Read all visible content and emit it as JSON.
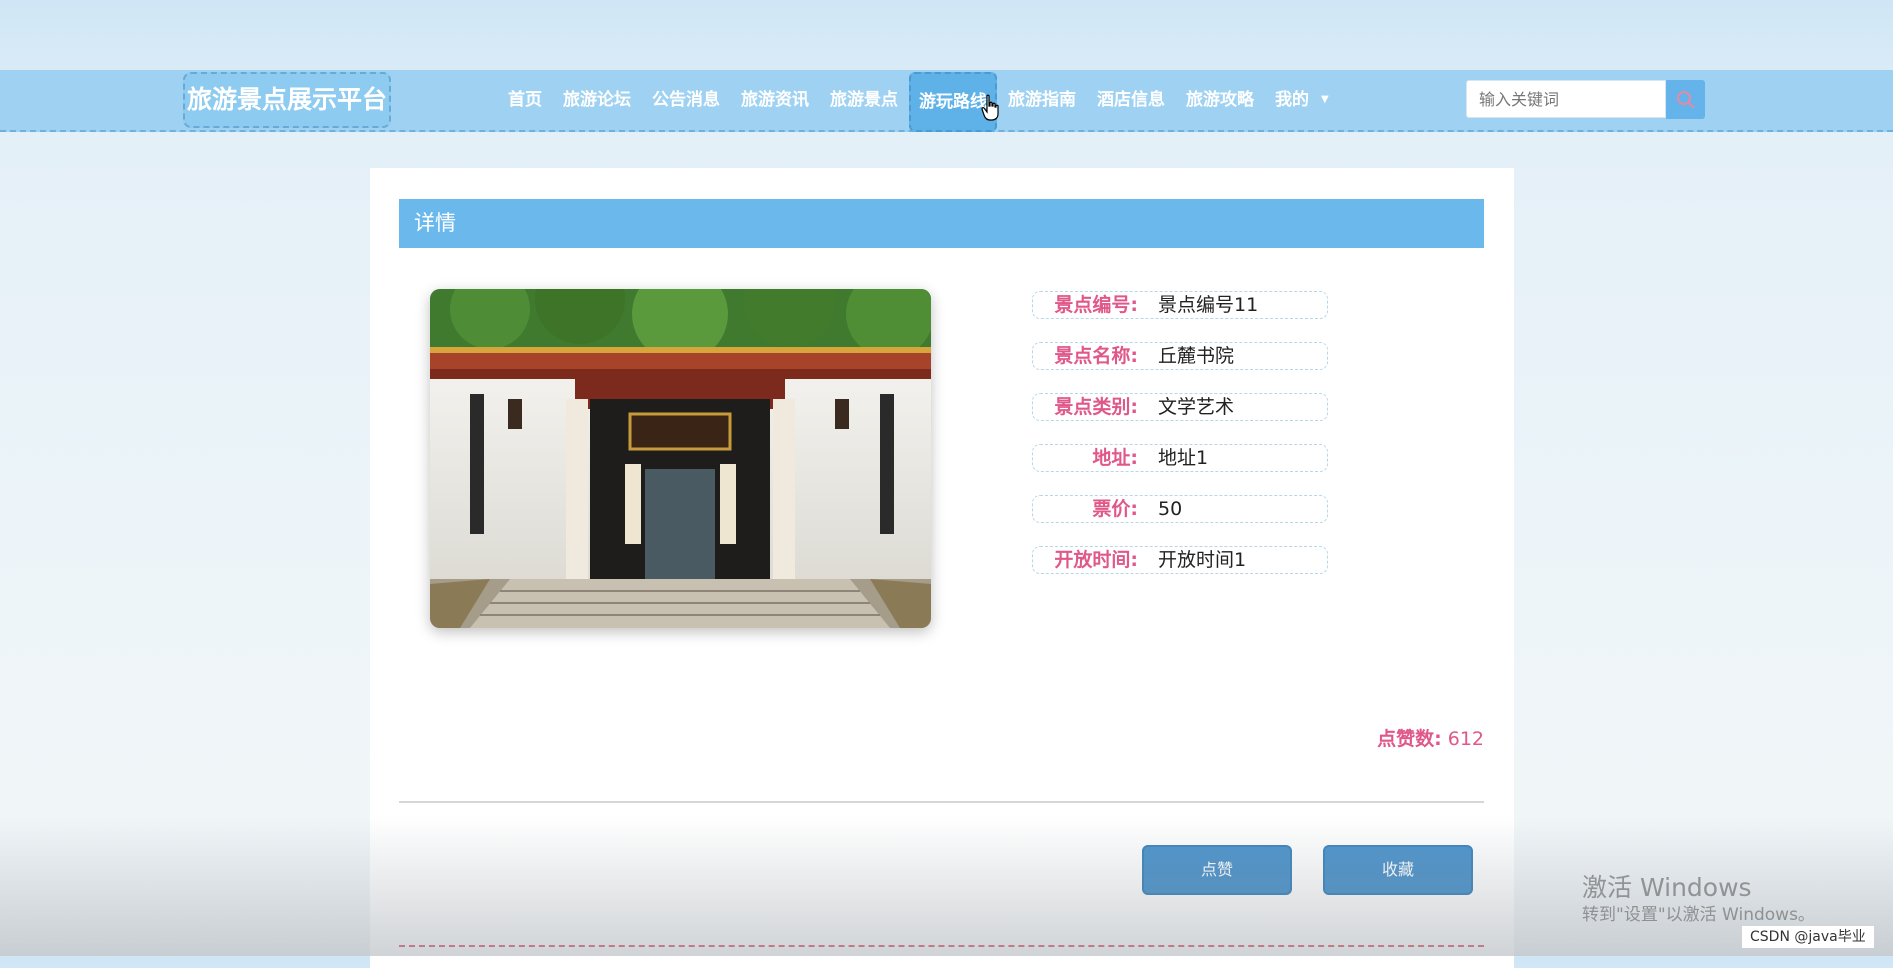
{
  "site": {
    "title": "旅游景点展示平台"
  },
  "nav": {
    "items": [
      "首页",
      "旅游论坛",
      "公告消息",
      "旅游资讯",
      "旅游景点",
      "游玩路线",
      "旅游指南",
      "酒店信息",
      "旅游攻略",
      "我的"
    ],
    "active_index": 5
  },
  "search": {
    "placeholder": "输入关键词"
  },
  "detail": {
    "heading": "详情",
    "fields": [
      {
        "label": "景点编号:",
        "value": "景点编号11"
      },
      {
        "label": "景点名称:",
        "value": "丘麓书院"
      },
      {
        "label": "景点类别:",
        "value": "文学艺术"
      },
      {
        "label": "地址:",
        "value": "地址1"
      },
      {
        "label": "票价:",
        "value": "50"
      },
      {
        "label": "开放时间:",
        "value": "开放时间1"
      }
    ],
    "likes_label": "点赞数:",
    "likes_count": "612"
  },
  "actions": {
    "like": "点赞",
    "favorite": "收藏"
  },
  "overlay": {
    "watermark_title": "激活 Windows",
    "watermark_sub": "转到\"设置\"以激活 Windows。",
    "csdn": "CSDN @java毕业"
  },
  "colors": {
    "nav_bg": "#9fd2f2",
    "accent": "#6bb8ec",
    "label_pink": "#e0588a",
    "button": "#4f95cc"
  }
}
